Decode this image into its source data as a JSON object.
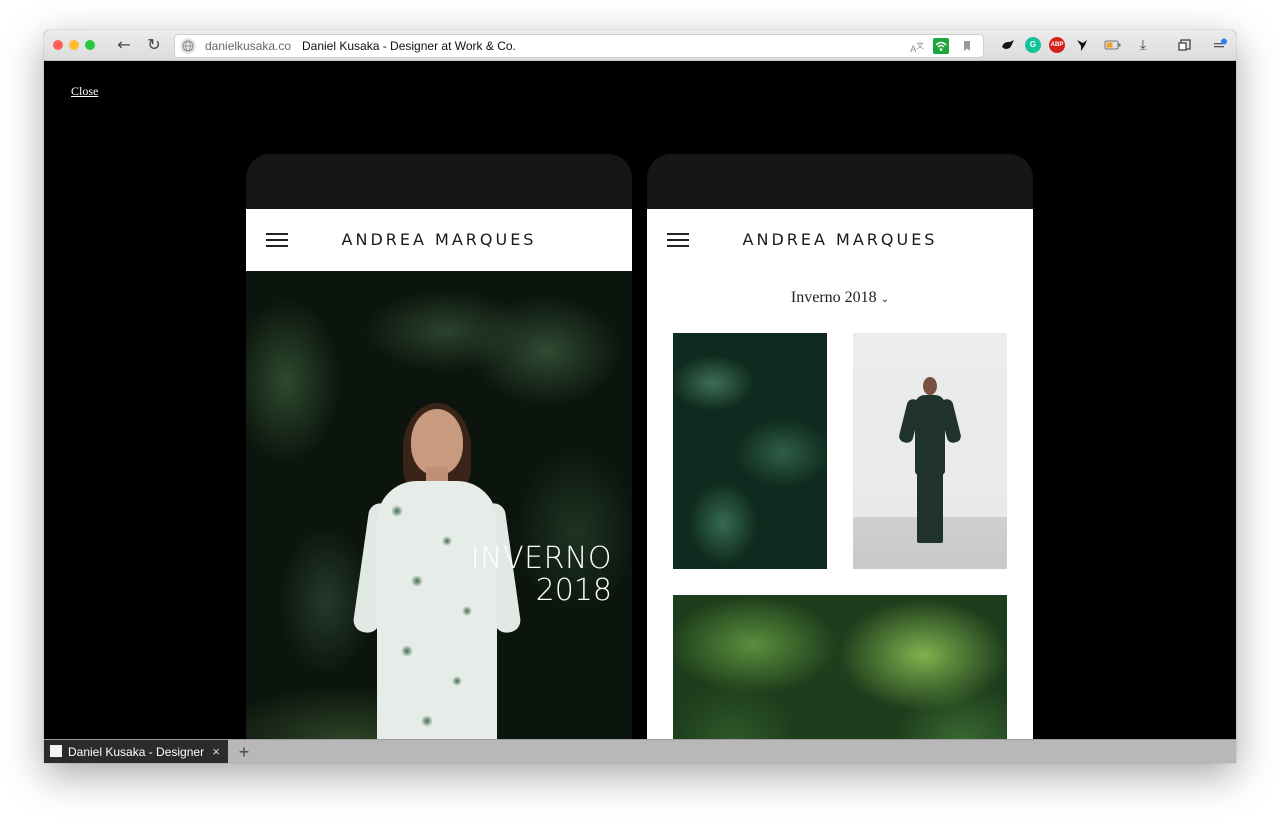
{
  "browser": {
    "domain": "danielkusaka.co",
    "title": "Daniel Kusaka - Designer at Work & Co.",
    "nav": {
      "back_icon": "←",
      "reload_icon": "↻"
    },
    "extensions": [
      {
        "name": "translate-icon",
        "glyph": "A",
        "color": "#888888"
      },
      {
        "name": "wifi-extension-icon",
        "glyph": "",
        "color": "#1ea53c"
      },
      {
        "name": "bookmark-icon",
        "glyph": "",
        "color": "#9a9a9a"
      },
      {
        "name": "dark-extension-icon",
        "glyph": "",
        "color": "#111111"
      },
      {
        "name": "grammarly-icon",
        "glyph": "G",
        "color": "#15c39a"
      },
      {
        "name": "adblock-plus-icon",
        "glyph": "ABP",
        "color": "#d4201b"
      },
      {
        "name": "bird-extension-icon",
        "glyph": "",
        "color": "#111111"
      },
      {
        "name": "battery-icon",
        "glyph": "",
        "color": "#f0a030"
      },
      {
        "name": "download-icon",
        "glyph": "⤓",
        "color": "#444444"
      },
      {
        "name": "cast-icon",
        "glyph": "",
        "color": "#444444"
      },
      {
        "name": "menu-icon",
        "glyph": "",
        "color": "#2d7cf6"
      }
    ]
  },
  "overlay": {
    "close_label": "Close"
  },
  "phone_left": {
    "brand": "ANDREA MARQUES",
    "hero_line1": "INVERNO",
    "hero_line2": "2018"
  },
  "phone_right": {
    "brand": "ANDREA MARQUES",
    "collection_label": "Inverno 2018",
    "collection_chevron": "⌄"
  },
  "tabs": [
    {
      "title": "Daniel Kusaka - Designer at Work & Co.",
      "close": "×"
    }
  ],
  "new_tab_label": "+",
  "colors": {
    "overlay_bg": "#000000",
    "phone_bar": "#161616",
    "traffic_red": "#ff5f57",
    "traffic_yellow": "#febc2e",
    "traffic_green": "#28c840"
  }
}
